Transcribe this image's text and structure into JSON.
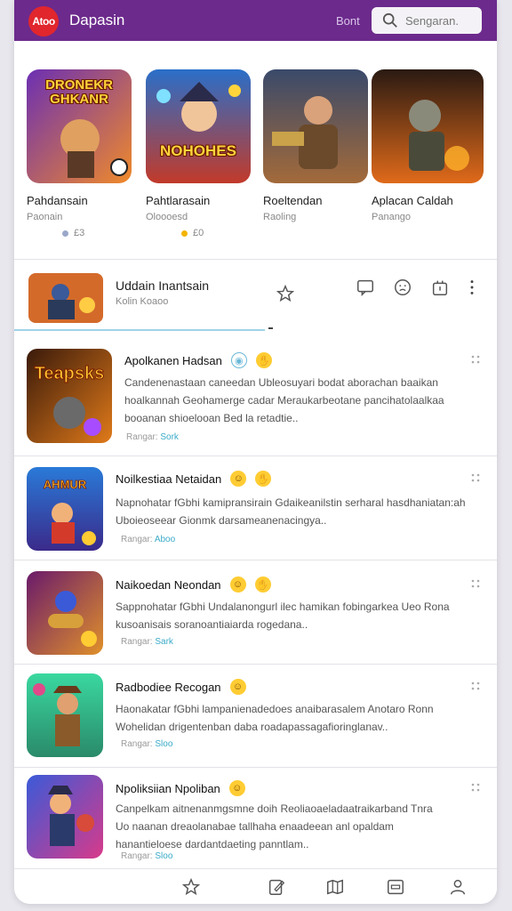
{
  "header": {
    "logo_text": "Atoo",
    "title": "Dapasin",
    "link_label": "Bont",
    "search_placeholder": "Sengaran."
  },
  "featured": [
    {
      "art_text": "DRONEKR GHKANR",
      "name": "Pahdansain",
      "sub": "Paonain",
      "rating": "£3",
      "dot_color": "#9aa7c8"
    },
    {
      "art_text": "NOHOHES",
      "name": "Pahtlarasain",
      "sub": "Oloooesd",
      "rating": "£0",
      "dot_color": "#f2b400"
    },
    {
      "art_text": "",
      "name": "Roeltendan",
      "sub": "Raoling",
      "rating": "",
      "dot_color": ""
    },
    {
      "art_text": "",
      "name": "Aplacan Caldah",
      "sub": "Panango",
      "rating": "",
      "dot_color": ""
    }
  ],
  "now_playing": {
    "title": "Uddain Inantsain",
    "sub": "Kolin Koaoo"
  },
  "items": [
    {
      "title": "Apolkanen Hadsan",
      "desc_lines": [
        "Candenenastaan caneedan Ubleosuyari bodat aborachan baaikan",
        "hoalkannah Geohamerge cadar Meraukarbeotane pancihatolaalkaa",
        "booanan shioelooan Bed la retadtie.."
      ],
      "meta_prefix": "Rangar:",
      "meta_value": "Sork"
    },
    {
      "title": "Noilkestiaa Netaidan",
      "desc_lines": [
        "Napnohatar fGbhi kamipransirain Gdaikeanilstin serharal hasdhaniatan:ah",
        "Uboieoseear Gionmk darsameanenacingya.."
      ],
      "meta_prefix": "Rangar:",
      "meta_value": "Aboo"
    },
    {
      "title": "Naikoedan Neondan",
      "desc_lines": [
        "Sappnohatar fGbhi Undalanongurl ilec hamikan fobingarkea Ueo Rona",
        "kusoanisais soranoantiaiarda rogedana.."
      ],
      "meta_prefix": "Rangar:",
      "meta_value": "Sark"
    },
    {
      "title": "Radbodiee Recogan",
      "desc_lines": [
        "Haonakatar fGbhi lampanienadedoes anaibarasalem Anotaro Ronn",
        "Wohelidan drigentenban daba roadapassagafioringlanav.."
      ],
      "meta_prefix": "Rangar:",
      "meta_value": "Sloo"
    },
    {
      "title": "Npoliksiian Npoliban",
      "desc_lines": [
        "Canpelkam aitnenanmgsmne doih Reoliaoaeladaatraikarband Tnra",
        "Uo naanan dreaolanabae tallhaha enaadeean anl opaldam",
        "hanantieloese dardantdaeting panntlam.."
      ],
      "meta_prefix": "Rangar:",
      "meta_value": "Sloo"
    }
  ]
}
